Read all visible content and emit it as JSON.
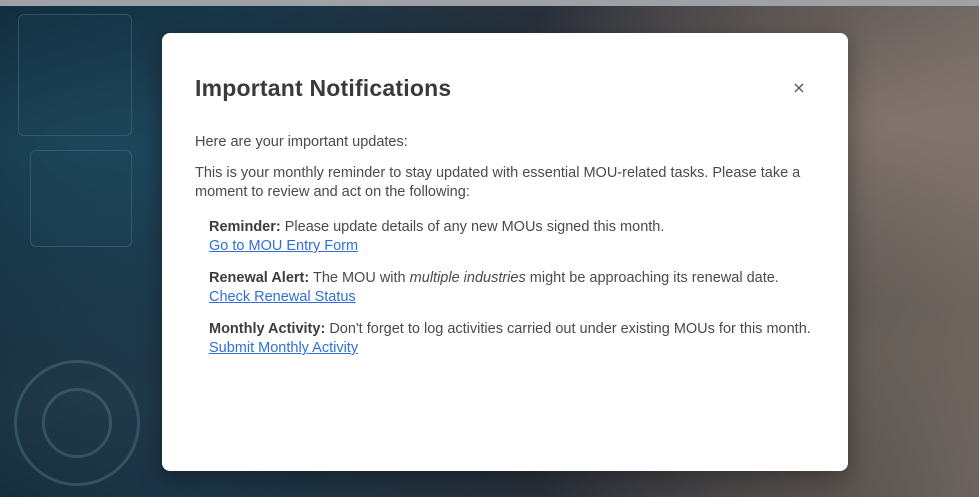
{
  "modal": {
    "title": "Important Notifications",
    "close_symbol": "×",
    "intro": "Here are your important updates:",
    "description": "This is your monthly reminder to stay updated with essential MOU-related tasks. Please take a moment to review and act on the following:",
    "items": [
      {
        "label": "Reminder:",
        "text": "Please update details of any new MOUs signed this month.",
        "link": "Go to MOU Entry Form"
      },
      {
        "label": "Renewal Alert:",
        "text_before": "The MOU with",
        "emphasis": "multiple industries",
        "text_after": "might be approaching its renewal date.",
        "link": "Check Renewal Status"
      },
      {
        "label": "Monthly Activity:",
        "text": "Don't forget to log activities carried out under existing MOUs for this month.",
        "link": "Submit Monthly Activity"
      }
    ]
  },
  "icons": {
    "close": "close-icon"
  },
  "colors": {
    "link": "#2f6fd6",
    "title": "#3a3a3a",
    "modal_bg": "#ffffff"
  }
}
